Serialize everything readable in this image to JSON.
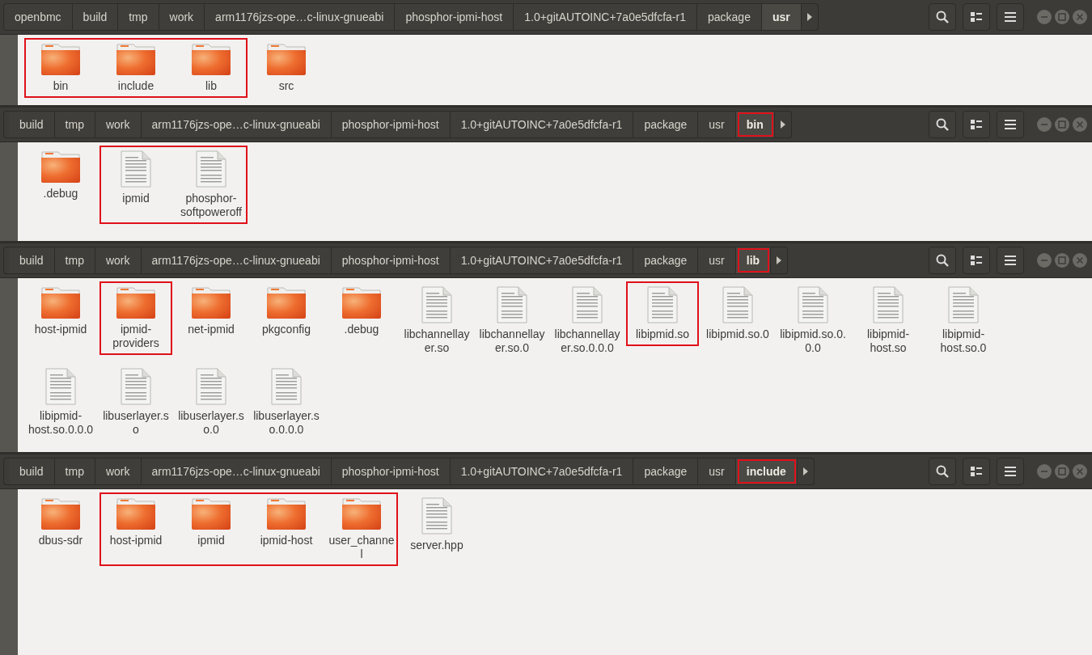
{
  "windows": [
    {
      "lead_stub": false,
      "breadcrumbs": [
        {
          "label": "openbmc",
          "selected": false,
          "highlighted": false
        },
        {
          "label": "build",
          "selected": false,
          "highlighted": false
        },
        {
          "label": "tmp",
          "selected": false,
          "highlighted": false
        },
        {
          "label": "work",
          "selected": false,
          "highlighted": false
        },
        {
          "label": "arm1176jzs-ope…c-linux-gnueabi",
          "selected": false,
          "highlighted": false
        },
        {
          "label": "phosphor-ipmi-host",
          "selected": false,
          "highlighted": false
        },
        {
          "label": "1.0+gitAUTOINC+7a0e5dfcfa-r1",
          "selected": false,
          "highlighted": false
        },
        {
          "label": "package",
          "selected": false,
          "highlighted": false
        },
        {
          "label": "usr",
          "selected": true,
          "highlighted": false
        }
      ],
      "files": [
        {
          "name": "bin",
          "kind": "folder",
          "highlighted": true
        },
        {
          "name": "include",
          "kind": "folder",
          "highlighted": true
        },
        {
          "name": "lib",
          "kind": "folder",
          "highlighted": true
        },
        {
          "name": "src",
          "kind": "folder",
          "highlighted": false
        }
      ]
    },
    {
      "lead_stub": true,
      "breadcrumbs": [
        {
          "label": "build",
          "selected": false,
          "highlighted": false
        },
        {
          "label": "tmp",
          "selected": false,
          "highlighted": false
        },
        {
          "label": "work",
          "selected": false,
          "highlighted": false
        },
        {
          "label": "arm1176jzs-ope…c-linux-gnueabi",
          "selected": false,
          "highlighted": false
        },
        {
          "label": "phosphor-ipmi-host",
          "selected": false,
          "highlighted": false
        },
        {
          "label": "1.0+gitAUTOINC+7a0e5dfcfa-r1",
          "selected": false,
          "highlighted": false
        },
        {
          "label": "package",
          "selected": false,
          "highlighted": false
        },
        {
          "label": "usr",
          "selected": false,
          "highlighted": false
        },
        {
          "label": "bin",
          "selected": true,
          "highlighted": true
        }
      ],
      "files": [
        {
          "name": ".debug",
          "kind": "folder",
          "highlighted": false
        },
        {
          "name": "ipmid",
          "kind": "file",
          "highlighted": true
        },
        {
          "name": "phosphor-softpoweroff",
          "kind": "file",
          "highlighted": true
        }
      ]
    },
    {
      "lead_stub": true,
      "breadcrumbs": [
        {
          "label": "build",
          "selected": false,
          "highlighted": false
        },
        {
          "label": "tmp",
          "selected": false,
          "highlighted": false
        },
        {
          "label": "work",
          "selected": false,
          "highlighted": false
        },
        {
          "label": "arm1176jzs-ope…c-linux-gnueabi",
          "selected": false,
          "highlighted": false
        },
        {
          "label": "phosphor-ipmi-host",
          "selected": false,
          "highlighted": false
        },
        {
          "label": "1.0+gitAUTOINC+7a0e5dfcfa-r1",
          "selected": false,
          "highlighted": false
        },
        {
          "label": "package",
          "selected": false,
          "highlighted": false
        },
        {
          "label": "usr",
          "selected": false,
          "highlighted": false
        },
        {
          "label": "lib",
          "selected": true,
          "highlighted": true
        }
      ],
      "files": [
        {
          "name": "host-ipmid",
          "kind": "folder",
          "highlighted": false
        },
        {
          "name": "ipmid-providers",
          "kind": "folder",
          "highlighted": true
        },
        {
          "name": "net-ipmid",
          "kind": "folder",
          "highlighted": false
        },
        {
          "name": "pkgconfig",
          "kind": "folder",
          "highlighted": false
        },
        {
          "name": ".debug",
          "kind": "folder",
          "highlighted": false
        },
        {
          "name": "libchannellayer.so",
          "kind": "file",
          "highlighted": false
        },
        {
          "name": "libchannellayer.so.0",
          "kind": "file",
          "highlighted": false
        },
        {
          "name": "libchannellayer.so.0.0.0",
          "kind": "file",
          "highlighted": false
        },
        {
          "name": "libipmid.so",
          "kind": "file",
          "highlighted": true
        },
        {
          "name": "libipmid.so.0",
          "kind": "file",
          "highlighted": false
        },
        {
          "name": "libipmid.so.0.0.0",
          "kind": "file",
          "highlighted": false
        },
        {
          "name": "libipmid-host.so",
          "kind": "file",
          "highlighted": false
        },
        {
          "name": "libipmid-host.so.0",
          "kind": "file",
          "highlighted": false
        },
        {
          "name": "libipmid-host.so.0.0.0",
          "kind": "file",
          "highlighted": false
        },
        {
          "name": "libuserlayer.so",
          "kind": "file",
          "highlighted": false
        },
        {
          "name": "libuserlayer.so.0",
          "kind": "file",
          "highlighted": false
        },
        {
          "name": "libuserlayer.so.0.0.0",
          "kind": "file",
          "highlighted": false
        }
      ]
    },
    {
      "lead_stub": true,
      "breadcrumbs": [
        {
          "label": "build",
          "selected": false,
          "highlighted": false
        },
        {
          "label": "tmp",
          "selected": false,
          "highlighted": false
        },
        {
          "label": "work",
          "selected": false,
          "highlighted": false
        },
        {
          "label": "arm1176jzs-ope…c-linux-gnueabi",
          "selected": false,
          "highlighted": false
        },
        {
          "label": "phosphor-ipmi-host",
          "selected": false,
          "highlighted": false
        },
        {
          "label": "1.0+gitAUTOINC+7a0e5dfcfa-r1",
          "selected": false,
          "highlighted": false
        },
        {
          "label": "package",
          "selected": false,
          "highlighted": false
        },
        {
          "label": "usr",
          "selected": false,
          "highlighted": false
        },
        {
          "label": "include",
          "selected": true,
          "highlighted": true
        }
      ],
      "files": [
        {
          "name": "dbus-sdr",
          "kind": "folder",
          "highlighted": false
        },
        {
          "name": "host-ipmid",
          "kind": "folder",
          "highlighted": true
        },
        {
          "name": "ipmid",
          "kind": "folder",
          "highlighted": true
        },
        {
          "name": "ipmid-host",
          "kind": "folder",
          "highlighted": true
        },
        {
          "name": "user_channel",
          "kind": "folder",
          "highlighted": true
        },
        {
          "name": "server.hpp",
          "kind": "file",
          "highlighted": false
        }
      ]
    }
  ]
}
